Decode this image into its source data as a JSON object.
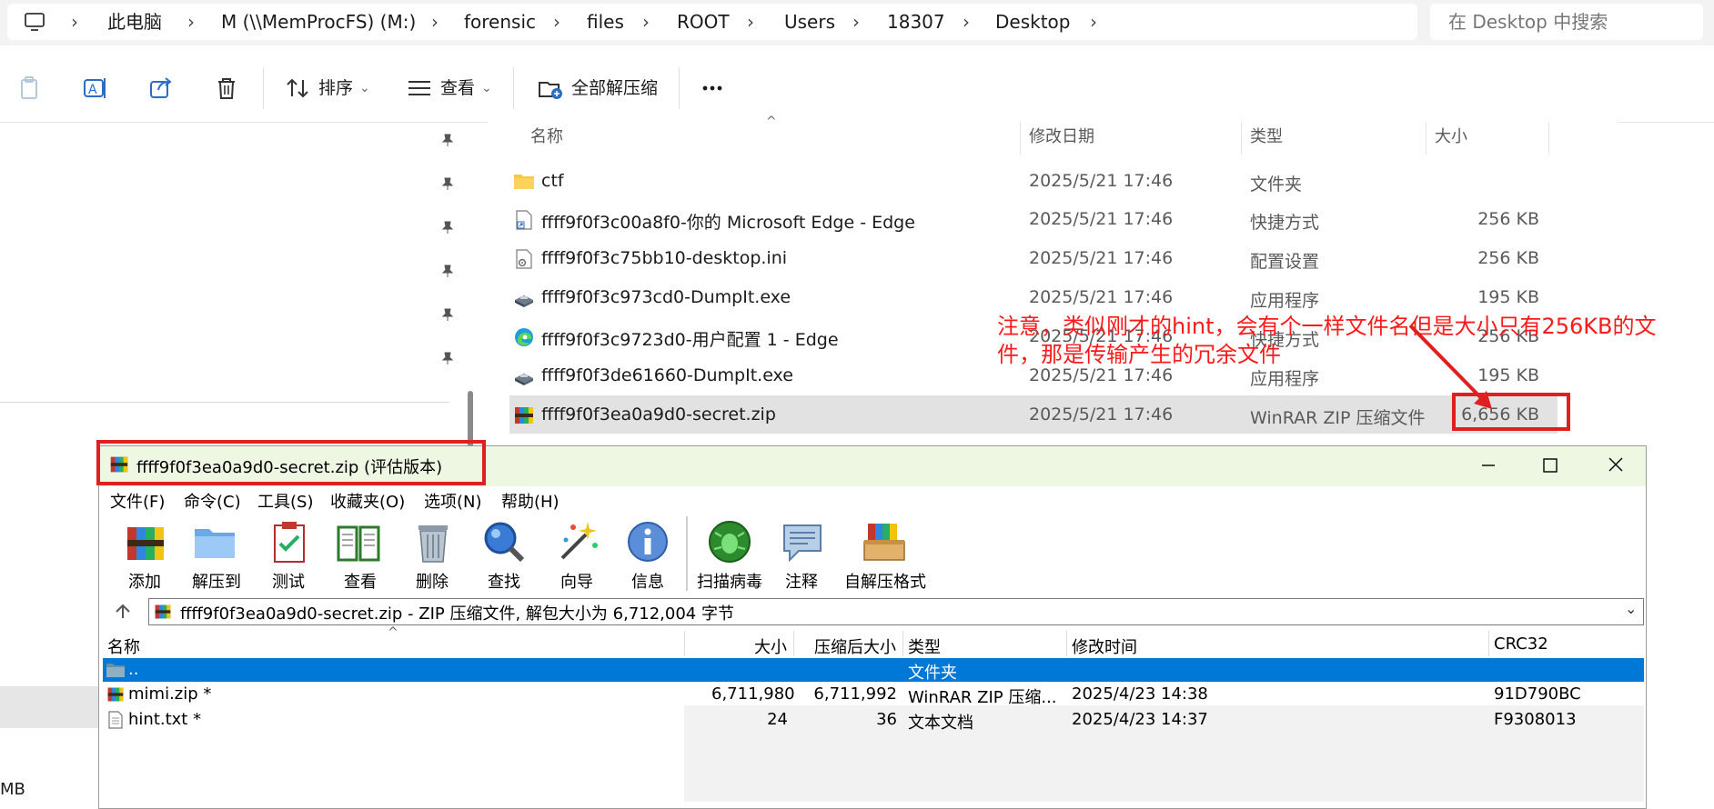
{
  "explorer": {
    "breadcrumb": [
      "此电脑",
      "M (\\\\MemProcFS) (M:)",
      "forensic",
      "files",
      "ROOT",
      "Users",
      "18307",
      "Desktop"
    ],
    "search_placeholder": "在 Desktop 中搜索",
    "commands": {
      "sort": "排序",
      "view": "查看",
      "extract_all": "全部解压缩"
    },
    "columns": {
      "name": "名称",
      "date": "修改日期",
      "type": "类型",
      "size": "大小"
    },
    "files": [
      {
        "name": "ctf",
        "date": "2025/5/21 17:46",
        "type": "文件夹",
        "size": "",
        "icon": "folder-icon"
      },
      {
        "name": "ffff9f0f3c00a8f0-你的 Microsoft Edge - Edge",
        "date": "2025/5/21 17:46",
        "type": "快捷方式",
        "size": "256 KB",
        "icon": "shortcut-icon"
      },
      {
        "name": "ffff9f0f3c75bb10-desktop.ini",
        "date": "2025/5/21 17:46",
        "type": "配置设置",
        "size": "256 KB",
        "icon": "ini-file-icon"
      },
      {
        "name": "ffff9f0f3c973cd0-DumpIt.exe",
        "date": "2025/5/21 17:46",
        "type": "应用程序",
        "size": "195 KB",
        "icon": "exe-icon"
      },
      {
        "name": "ffff9f0f3c9723d0-用户配置 1 - Edge",
        "date": "2025/5/21 17:46",
        "type": "快捷方式",
        "size": "256 KB",
        "icon": "edge-icon"
      },
      {
        "name": "ffff9f0f3de61660-DumpIt.exe",
        "date": "2025/5/21 17:46",
        "type": "应用程序",
        "size": "195 KB",
        "icon": "exe-icon"
      },
      {
        "name": "ffff9f0f3ea0a9d0-secret.zip",
        "date": "2025/5/21 17:46",
        "type": "WinRAR ZIP 压缩文件",
        "size": "6,656 KB",
        "icon": "winrar-icon",
        "selected": true
      }
    ],
    "nav_partial_text": "MB"
  },
  "annotation": {
    "text": "注意，类似刚才的hint，会有个一样文件名但是大小只有256KB的文件，那是传输产生的冗余文件",
    "color": "#ff1a1a"
  },
  "winrar": {
    "title": "ffff9f0f3ea0a9d0-secret.zip (评估版本)",
    "menu": [
      "文件(F)",
      "命令(C)",
      "工具(S)",
      "收藏夹(O)",
      "选项(N)",
      "帮助(H)"
    ],
    "toolbar": [
      "添加",
      "解压到",
      "测试",
      "查看",
      "删除",
      "查找",
      "向导",
      "信息",
      "扫描病毒",
      "注释",
      "自解压格式"
    ],
    "path": "ffff9f0f3ea0a9d0-secret.zip - ZIP 压缩文件, 解包大小为 6,712,004 字节",
    "columns": {
      "name": "名称",
      "size": "大小",
      "packed": "压缩后大小",
      "type": "类型",
      "modified": "修改时间",
      "crc": "CRC32"
    },
    "rows": [
      {
        "name": "..",
        "size": "",
        "packed": "",
        "type": "文件夹",
        "modified": "",
        "crc": ""
      },
      {
        "name": "mimi.zip *",
        "size": "6,711,980",
        "packed": "6,711,992",
        "type": "WinRAR ZIP 压缩...",
        "modified": "2025/4/23 14:38",
        "crc": "91D790BC"
      },
      {
        "name": "hint.txt *",
        "size": "24",
        "packed": "36",
        "type": "文本文档",
        "modified": "2025/4/23 14:37",
        "crc": "F9308013"
      }
    ],
    "selection_color": "#0078d7",
    "title_bg": "#eef7e2"
  }
}
